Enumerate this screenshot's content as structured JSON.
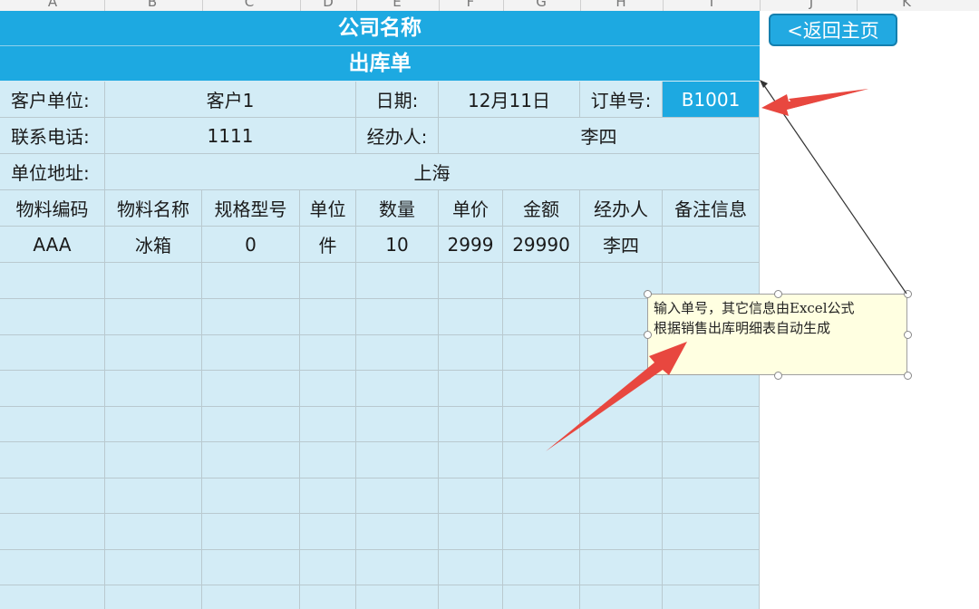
{
  "column_headers": [
    "A",
    "B",
    "C",
    "D",
    "E",
    "F",
    "G",
    "H",
    "I",
    "J",
    "K"
  ],
  "header": {
    "company": "公司名称",
    "doc_title": "出库单"
  },
  "info": {
    "customer_label": "客户单位:",
    "customer_value": "客户1",
    "date_label": "日期:",
    "date_value": "12月11日",
    "order_label": "订单号:",
    "order_value": "B1001",
    "phone_label": "联系电话:",
    "phone_value": "1111",
    "handler_label": "经办人:",
    "handler_value": "李四",
    "address_label": "单位地址:",
    "address_value": "上海"
  },
  "table": {
    "columns": [
      "物料编码",
      "物料名称",
      "规格型号",
      "单位",
      "数量",
      "单价",
      "金额",
      "经办人",
      "备注信息"
    ],
    "rows": [
      [
        "AAA",
        "冰箱",
        "0",
        "件",
        "10",
        "2999",
        "29990",
        "李四",
        ""
      ]
    ]
  },
  "back_button": {
    "label": "<返回主页"
  },
  "comment": {
    "line1": "输入单号，其它信息由Excel公式",
    "line2": "根据销售出库明细表自动生成"
  },
  "colors": {
    "header_blue": "#1da9e1",
    "sheet_bg": "#d3ecf6",
    "arrow_red": "#e8473f",
    "note_bg": "#ffffe1"
  }
}
